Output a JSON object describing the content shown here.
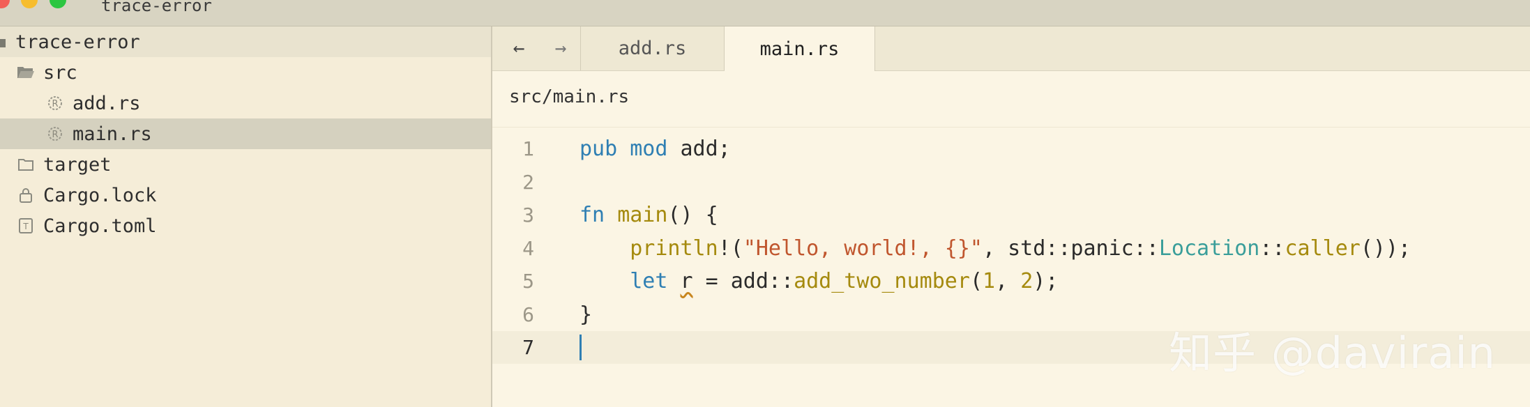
{
  "window": {
    "title": "trace-error"
  },
  "sidebar": {
    "items": [
      {
        "label": "trace-error",
        "icon": "folder-icon"
      },
      {
        "label": "src",
        "icon": "folder-open-icon"
      },
      {
        "label": "add.rs",
        "icon": "rust-file-icon"
      },
      {
        "label": "main.rs",
        "icon": "rust-file-icon",
        "selected": true
      },
      {
        "label": "target",
        "icon": "folder-icon"
      },
      {
        "label": "Cargo.lock",
        "icon": "lock-file-icon"
      },
      {
        "label": "Cargo.toml",
        "icon": "toml-file-icon"
      }
    ]
  },
  "tabs": {
    "back": "←",
    "forward": "→",
    "items": [
      {
        "label": "add.rs",
        "active": false
      },
      {
        "label": "main.rs",
        "active": true
      }
    ]
  },
  "editor": {
    "breadcrumb": "src/main.rs",
    "lines": [
      {
        "number": "1",
        "tokens": [
          {
            "t": "pub",
            "c": "kw"
          },
          {
            "t": " "
          },
          {
            "t": "mod",
            "c": "kw"
          },
          {
            "t": " add;"
          }
        ]
      },
      {
        "number": "2",
        "tokens": []
      },
      {
        "number": "3",
        "tokens": [
          {
            "t": "fn",
            "c": "kw"
          },
          {
            "t": " "
          },
          {
            "t": "main",
            "c": "fn"
          },
          {
            "t": "() {"
          }
        ]
      },
      {
        "number": "4",
        "tokens": [
          {
            "t": "    "
          },
          {
            "t": "println",
            "c": "mac"
          },
          {
            "t": "!("
          },
          {
            "t": "\"Hello, world!, {}\"",
            "c": "str"
          },
          {
            "t": ", std::panic::"
          },
          {
            "t": "Location",
            "c": "ty"
          },
          {
            "t": "::"
          },
          {
            "t": "caller",
            "c": "fn"
          },
          {
            "t": "());"
          }
        ]
      },
      {
        "number": "5",
        "tokens": [
          {
            "t": "    "
          },
          {
            "t": "let",
            "c": "kw"
          },
          {
            "t": " "
          },
          {
            "t": "r",
            "c": "squig"
          },
          {
            "t": " = add::"
          },
          {
            "t": "add_two_number",
            "c": "fn"
          },
          {
            "t": "("
          },
          {
            "t": "1",
            "c": "num"
          },
          {
            "t": ", "
          },
          {
            "t": "2",
            "c": "num"
          },
          {
            "t": ");"
          }
        ]
      },
      {
        "number": "6",
        "tokens": [
          {
            "t": "}"
          }
        ]
      },
      {
        "number": "7",
        "tokens": [],
        "current": true
      }
    ]
  },
  "watermark": "知乎 @davirain"
}
